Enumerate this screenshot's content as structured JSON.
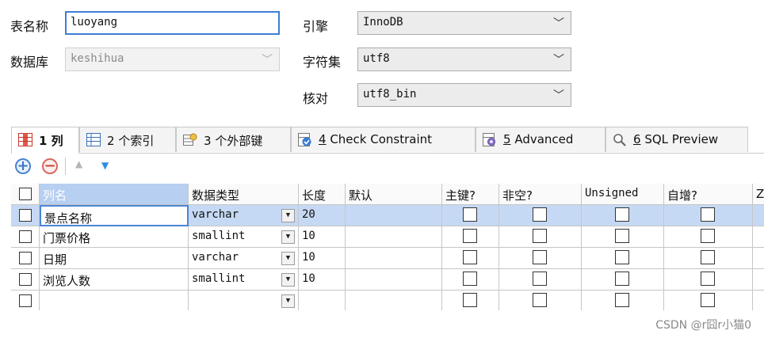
{
  "form": {
    "table_name_label": "表名称",
    "table_name_value": "luoyang",
    "database_label": "数据库",
    "database_value": "keshihua",
    "engine_label": "引擎",
    "engine_value": "InnoDB",
    "charset_label": "字符集",
    "charset_value": "utf8",
    "collation_label": "核对",
    "collation_value": "utf8_bin"
  },
  "tabs": [
    {
      "number": "1",
      "label": "列"
    },
    {
      "number": "2",
      "label": "个索引"
    },
    {
      "number": "3",
      "label": "个外部键"
    },
    {
      "number": "4",
      "label": "Check Constraint"
    },
    {
      "number": "5",
      "label": "Advanced"
    },
    {
      "number": "6",
      "label": "SQL Preview"
    }
  ],
  "toolbar": {
    "add_symbol": "+",
    "remove_symbol": "−",
    "up_symbol": "▲",
    "down_symbol": "▼"
  },
  "columns": {
    "name": "列名",
    "datatype": "数据类型",
    "length": "长度",
    "default": "默认",
    "primary_key": "主键?",
    "not_null": "非空?",
    "unsigned": "Unsigned",
    "auto_increment": "自增?",
    "zerofill": "Z"
  },
  "rows": [
    {
      "name": "景点名称",
      "datatype": "varchar",
      "length": "20"
    },
    {
      "name": "门票价格",
      "datatype": "smallint",
      "length": "10"
    },
    {
      "name": "日期",
      "datatype": "varchar",
      "length": "10"
    },
    {
      "name": "浏览人数",
      "datatype": "smallint",
      "length": "10"
    },
    {
      "name": "",
      "datatype": "",
      "length": ""
    }
  ],
  "watermark": "CSDN @r囧r小猫0",
  "colors": {
    "selection": "#c6d9f4",
    "focus_border": "#3d7fd6"
  }
}
